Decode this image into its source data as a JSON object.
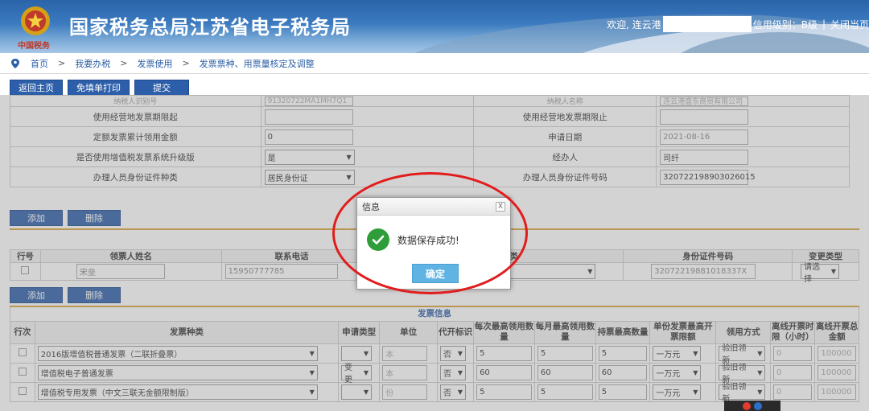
{
  "header": {
    "title": "国家税务总局江苏省电子税务局",
    "emblem_text": "中国税务",
    "welcome": "欢迎, 连云港",
    "credit": "信用级别：B级",
    "close": "关闭当页"
  },
  "breadcrumb": [
    "首页",
    "我要办税",
    "发票使用",
    "发票票种、用票量核定及调整"
  ],
  "toolbar": {
    "back": "返回主页",
    "print": "免填单打印",
    "submit": "提交"
  },
  "form": {
    "rows": [
      {
        "l1": "纳税人识别号",
        "v1": "91320722MA1MH7Q1",
        "l2": "纳税人名称",
        "v2": "连云港盛东商贸有限公司"
      },
      {
        "l1": "使用经营地发票期限起",
        "v1": "",
        "l2": "使用经营地发票期限止",
        "v2": ""
      },
      {
        "l1": "定额发票累计领用金额",
        "v1": "0",
        "l2": "申请日期",
        "v2": "2021-08-16"
      },
      {
        "l1": "是否使用增值税发票系统升级版",
        "v1": "是",
        "l2": "经办人",
        "v2": "司纤"
      },
      {
        "l1": "办理人员身份证件种类",
        "v1": "居民身份证",
        "l2": "办理人员身份证件号码",
        "v2": "320722198903026015"
      }
    ]
  },
  "buttons": {
    "add": "添加",
    "delete": "删除"
  },
  "collector": {
    "headers": [
      "行号",
      "领票人姓名",
      "联系电话",
      "身份证件种类",
      "身份证件号码",
      "变更类型"
    ],
    "row": {
      "name": "宋垒",
      "phone": "15950777785",
      "id_type": "",
      "id_no": "32072219881018337X",
      "change": "请选择"
    }
  },
  "invoice": {
    "caption": "发票信息",
    "headers": [
      "行次",
      "发票种类",
      "申请类型",
      "单位",
      "代开标识",
      "每次最高领用数量",
      "每月最高领用数量",
      "持票最高数量",
      "单份发票最高开票限额",
      "领用方式",
      "离线开票时限（小时）",
      "离线开票总金额"
    ],
    "rows": [
      {
        "kind": "2016版增值税普通发票（二联折叠票）",
        "apply": "",
        "unit": "本",
        "proxy": "否",
        "per": "5",
        "month": "5",
        "hold": "5",
        "limit": "一万元",
        "mode": "验旧领新",
        "hours": "0",
        "amount": "100000"
      },
      {
        "kind": "增值税电子普通发票",
        "apply": "变更",
        "unit": "本",
        "proxy": "否",
        "per": "60",
        "month": "60",
        "hold": "60",
        "limit": "一万元",
        "mode": "验旧领新",
        "hours": "0",
        "amount": "100000"
      },
      {
        "kind": "增值税专用发票（中文三联无金额限制版）",
        "apply": "",
        "unit": "份",
        "proxy": "否",
        "per": "5",
        "month": "5",
        "hold": "5",
        "limit": "一万元",
        "mode": "验旧领新",
        "hours": "0",
        "amount": "100000"
      }
    ]
  },
  "dialog": {
    "title": "信息",
    "message": "数据保存成功!",
    "confirm": "确定",
    "close": "X"
  }
}
